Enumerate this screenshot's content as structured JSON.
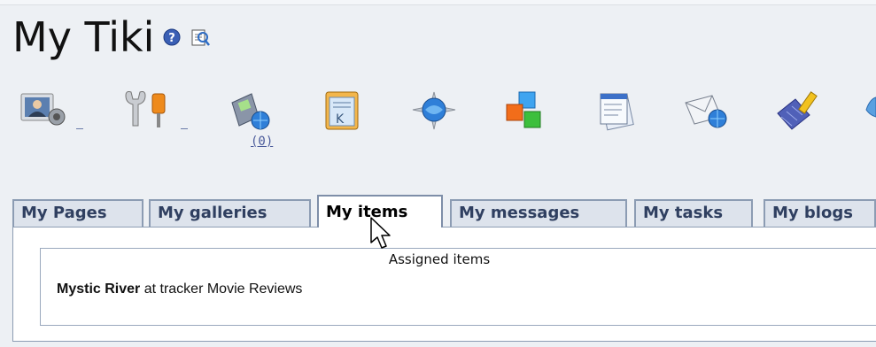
{
  "page": {
    "title": "My Tiki",
    "help_icon": "help-icon",
    "edit_icon": "edit-page-icon"
  },
  "toolbar": {
    "icons": [
      {
        "name": "user-preferences-icon"
      },
      {
        "name": "admin-tools-icon"
      },
      {
        "name": "mobile-notifications-icon",
        "count": "(0)"
      },
      {
        "name": "notepad-icon"
      },
      {
        "name": "webmail-icon"
      },
      {
        "name": "modules-icon"
      },
      {
        "name": "user-files-icon"
      },
      {
        "name": "messages-icon"
      },
      {
        "name": "tasks-icon"
      },
      {
        "name": "partial-icon"
      }
    ]
  },
  "tabs": [
    {
      "label": "My Pages"
    },
    {
      "label": "My galleries"
    },
    {
      "label": "My items",
      "active": true
    },
    {
      "label": "My messages"
    },
    {
      "label": "My tasks"
    },
    {
      "label": "My blogs"
    }
  ],
  "panel": {
    "heading": "Assigned items",
    "item_name": "Mystic River",
    "item_suffix": " at tracker Movie Reviews"
  },
  "colors": {
    "background": "#edf0f4",
    "tab_border": "#8c9cb3",
    "tab_text": "#2f3f60",
    "link": "#4a5a9a"
  }
}
